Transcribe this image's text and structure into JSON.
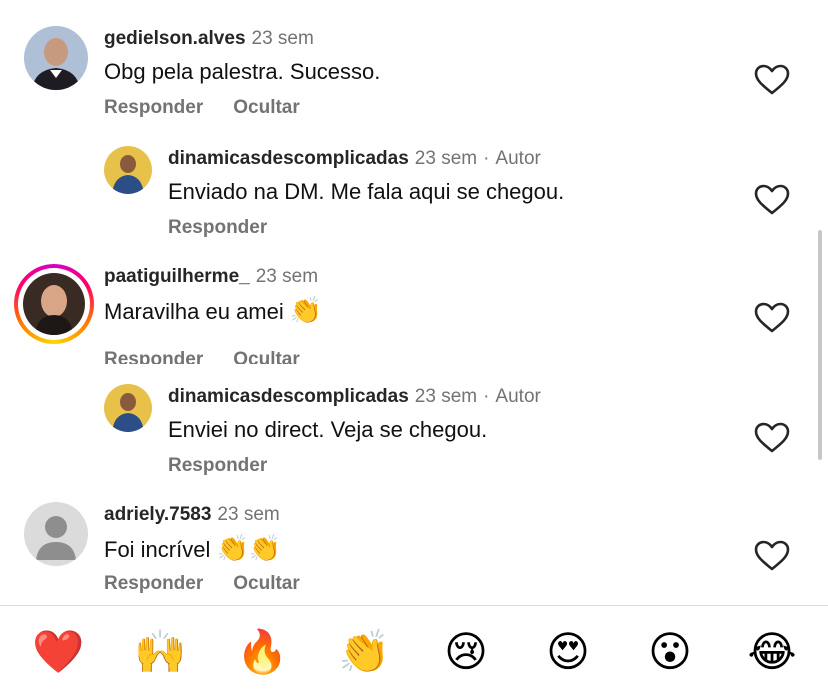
{
  "comments": [
    {
      "user": "gedielson.alves",
      "time": "23 sem",
      "text": "Obg pela palestra. Sucesso.",
      "reply_label": "Responder",
      "hide_label": "Ocultar"
    },
    {
      "user": "dinamicasdescomplicadas",
      "time": "23 sem",
      "author_label": "Autor",
      "text": "Enviado na DM. Me fala aqui se chegou.",
      "reply_label": "Responder"
    },
    {
      "user": "paatiguilherme_",
      "time": "23 sem",
      "text": "Maravilha eu amei",
      "emoji": "👏",
      "reply_label": "Responder",
      "hide_label": "Ocultar"
    },
    {
      "user": "dinamicasdescomplicadas",
      "time": "23 sem",
      "author_label": "Autor",
      "text": "Enviei no direct. Veja se chegou.",
      "reply_label": "Responder"
    },
    {
      "user": "adriely.7583",
      "time": "23 sem",
      "text": "Foi incrível",
      "emoji": "👏👏",
      "reply_label": "Responder",
      "hide_label": "Ocultar"
    }
  ],
  "separator": "·",
  "reaction_bar": [
    "❤️",
    "🙌",
    "🔥",
    "👏",
    "😢",
    "😍",
    "😮",
    "😂"
  ],
  "colors": {
    "username": "#262626",
    "secondary": "#737373",
    "divider": "#dbdbdb"
  },
  "icons": {
    "like": "heart-outline-icon"
  }
}
